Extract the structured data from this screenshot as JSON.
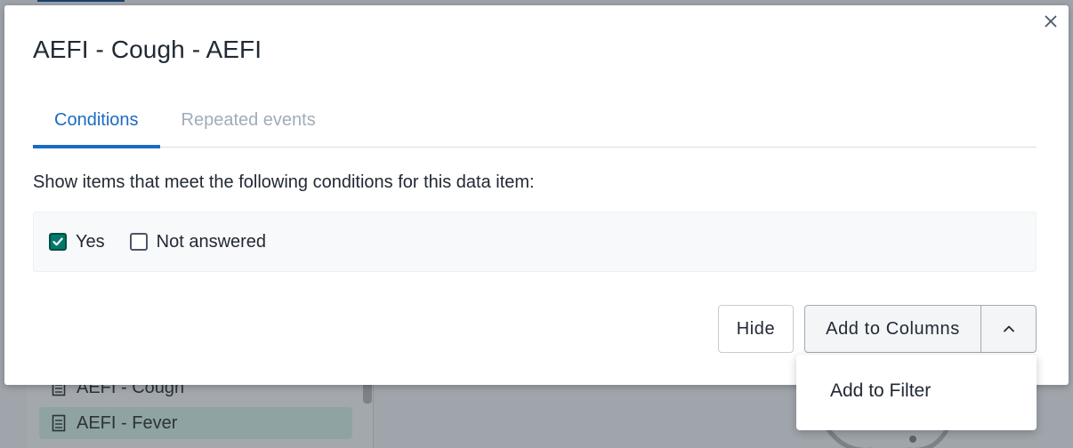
{
  "background": {
    "sidebar_items": [
      {
        "label": "AEFI - Cough",
        "icon": "data-item-icon"
      },
      {
        "label": "AEFI - Fever",
        "icon": "data-item-icon"
      }
    ]
  },
  "modal": {
    "title": "AEFI - Cough - AEFI",
    "close_icon": "close-icon",
    "tabs": [
      {
        "label": "Conditions",
        "active": true
      },
      {
        "label": "Repeated events",
        "active": false
      }
    ],
    "description": "Show items that meet the following conditions for this data item:",
    "conditions": [
      {
        "label": "Yes",
        "checked": true
      },
      {
        "label": "Not answered",
        "checked": false
      }
    ],
    "buttons": {
      "hide": "Hide",
      "add_to_columns": "Add to Columns",
      "toggle_icon": "chevron-up-icon"
    },
    "menu": {
      "items": [
        {
          "label": "Add to Filter"
        }
      ]
    }
  },
  "colors": {
    "accent": "#1c6bc2",
    "checkbox_checked": "#00796b",
    "overlay": "#a0a5ab"
  }
}
